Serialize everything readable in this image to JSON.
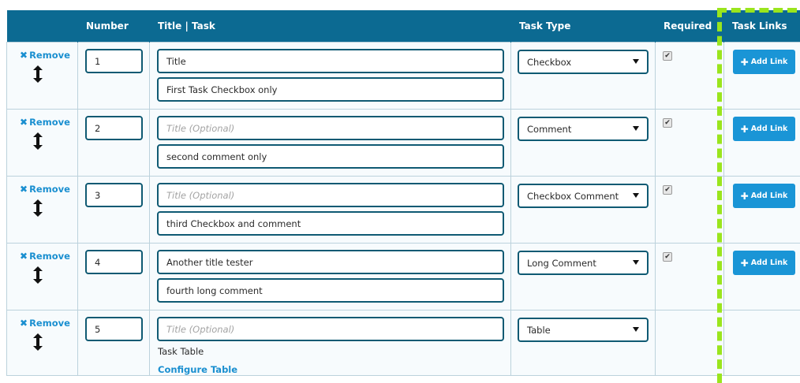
{
  "columns": {
    "remove": "",
    "number": "Number",
    "title": "Title | Task",
    "type": "Task Type",
    "required": "Required",
    "links": "Task Links"
  },
  "labels": {
    "remove": "Remove",
    "add_link": "Add Link",
    "configure_table": "Configure Table",
    "task_table": "Task Table",
    "title_placeholder": "Title (Optional)"
  },
  "rows": [
    {
      "number": "1",
      "title": "Title",
      "task": "First Task Checkbox only",
      "type": "Checkbox",
      "required": true
    },
    {
      "number": "2",
      "title": "",
      "task": "second comment only",
      "type": "Comment",
      "required": true
    },
    {
      "number": "3",
      "title": "",
      "task": "third Checkbox and comment",
      "type": "Checkbox Comment",
      "required": true
    },
    {
      "number": "4",
      "title": "Another title tester",
      "task": "fourth long comment",
      "type": "Long Comment",
      "required": true
    },
    {
      "number": "5",
      "title": "",
      "task": "",
      "type": "Table",
      "required": false
    }
  ],
  "colors": {
    "header_bg": "#0c6a92",
    "link": "#1a8fd0",
    "button": "#1a95d6",
    "highlight": "#9ae51d"
  }
}
